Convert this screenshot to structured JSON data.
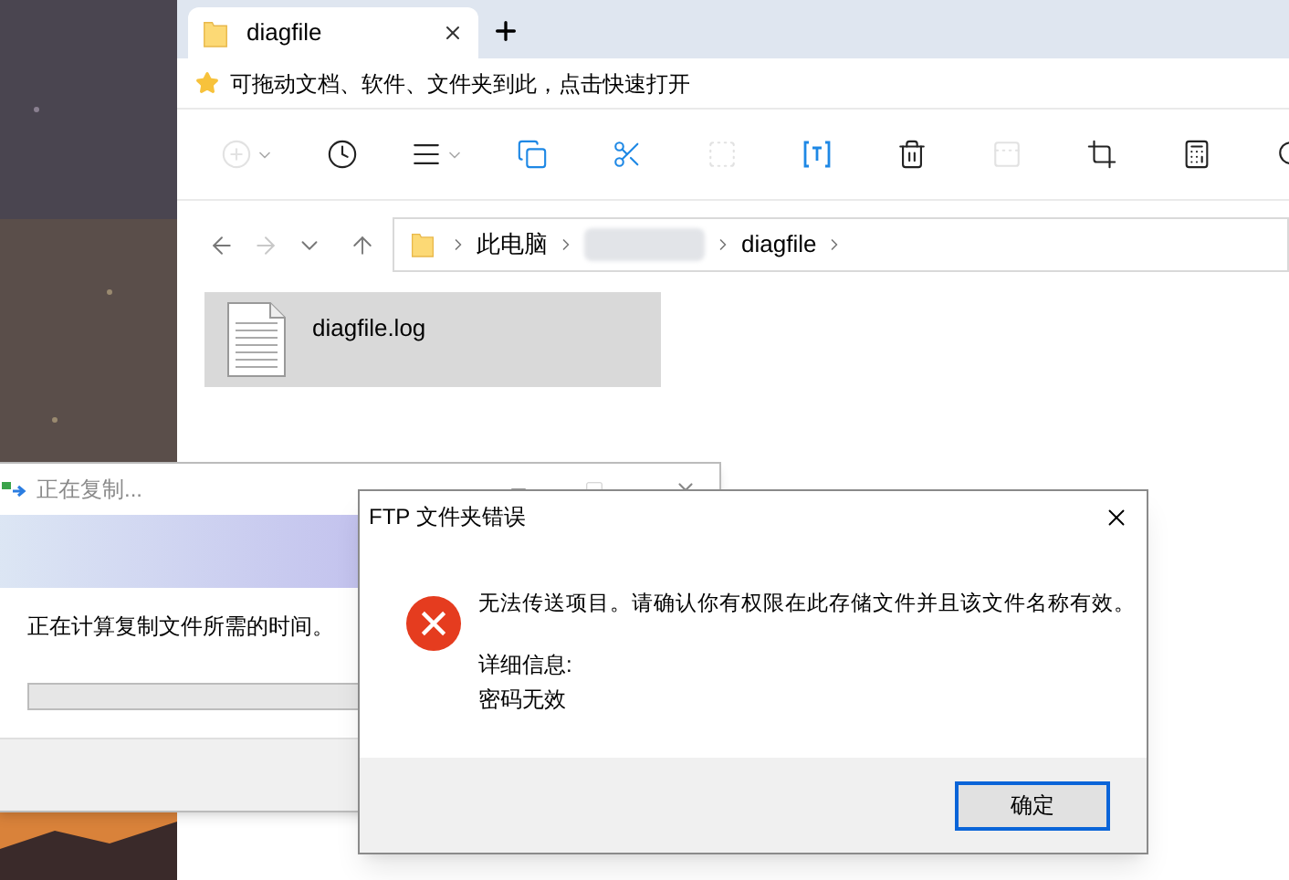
{
  "explorer": {
    "tab": {
      "title": "diagfile",
      "selected": true
    },
    "favorites_bar": {
      "hint": "可拖动文档、软件、文件夹到此，点击快速打开"
    },
    "toolbar": [
      {
        "disabled": true
      },
      {
        "disabled": false
      },
      {
        "disabled": false
      },
      {
        "disabled": false
      },
      {
        "disabled": false
      },
      {
        "disabled": true
      },
      {
        "disabled": false
      },
      {
        "disabled": false
      },
      {
        "disabled": true
      },
      {
        "disabled": false
      },
      {
        "disabled": false
      },
      {
        "disabled": false
      }
    ],
    "navigation": [
      {
        "disabled": false
      },
      {
        "disabled": true
      },
      {
        "disabled": false
      },
      {
        "disabled": false
      }
    ],
    "breadcrumb": [
      {
        "kind": "crumb",
        "label": "此电脑"
      },
      {
        "kind": "redacted"
      },
      {
        "kind": "crumb",
        "label": "diagfile"
      }
    ],
    "files": [
      {
        "name": "diagfile.log",
        "selected": true
      }
    ]
  },
  "copy_dialog": {
    "title": "正在复制...",
    "message": "正在计算复制文件所需的时间。",
    "progress": {
      "level": 0
    }
  },
  "error_dialog": {
    "title": "FTP 文件夹错误",
    "message": "无法传送项目。请确认你有权限在此存储文件并且该文件名称有效。",
    "details_label": "详细信息:",
    "details": "密码无效",
    "buttons": [
      {
        "label": "确定",
        "selected": true
      }
    ]
  }
}
